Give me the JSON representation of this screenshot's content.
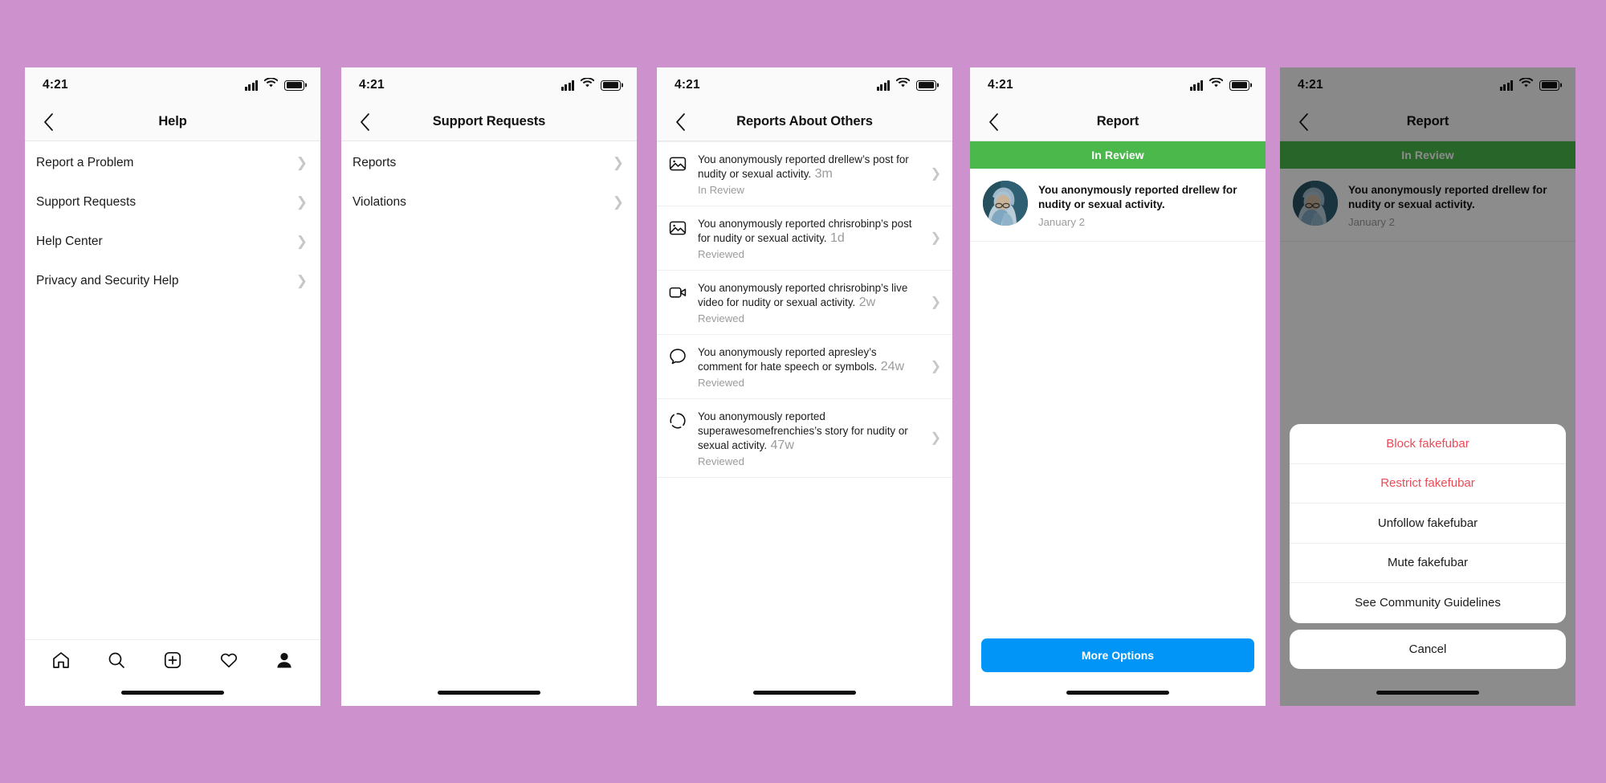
{
  "background_color": "#cd92ce",
  "accent_colors": {
    "primary_button": "#0095f6",
    "banner_green": "#4ab84a",
    "destructive_red": "#ed4956",
    "muted_text": "#9b9b9b"
  },
  "status_bar": {
    "time": "4:21",
    "signal_icon": "cellular-signal-icon",
    "wifi_icon": "wifi-icon",
    "battery_icon": "battery-full-icon"
  },
  "tab_bar": {
    "items": [
      {
        "name": "home",
        "icon": "home-icon"
      },
      {
        "name": "search",
        "icon": "search-icon"
      },
      {
        "name": "create",
        "icon": "plus-square-icon"
      },
      {
        "name": "activity",
        "icon": "heart-icon"
      },
      {
        "name": "profile",
        "icon": "profile-person-icon"
      }
    ]
  },
  "screens": [
    {
      "id": "help",
      "title": "Help",
      "back_icon": "chevron-left-icon",
      "items": [
        {
          "label": "Report a Problem"
        },
        {
          "label": "Support Requests"
        },
        {
          "label": "Help Center"
        },
        {
          "label": "Privacy and Security Help"
        }
      ]
    },
    {
      "id": "support-requests",
      "title": "Support Requests",
      "back_icon": "chevron-left-icon",
      "items": [
        {
          "label": "Reports"
        },
        {
          "label": "Violations"
        }
      ]
    },
    {
      "id": "reports-about-others",
      "title": "Reports About Others",
      "back_icon": "chevron-left-icon",
      "reports": [
        {
          "icon": "photo-icon",
          "text": "You anonymously reported drellew’s post for nudity or sexual activity.",
          "time": "3m",
          "status": "In Review"
        },
        {
          "icon": "photo-icon",
          "text": "You anonymously reported chrisrobinp’s post for nudity or sexual activity.",
          "time": "1d",
          "status": "Reviewed"
        },
        {
          "icon": "video-camera-icon",
          "text": "You anonymously reported chrisrobinp’s live video for nudity or sexual activity.",
          "time": "2w",
          "status": "Reviewed"
        },
        {
          "icon": "comment-bubble-icon",
          "text": "You anonymously reported apresley’s comment for hate speech or symbols.",
          "time": "24w",
          "status": "Reviewed"
        },
        {
          "icon": "story-ring-icon",
          "text": "You anonymously reported superawesomefrenchies’s story for nudity or sexual activity.",
          "time": "47w",
          "status": "Reviewed"
        }
      ]
    },
    {
      "id": "report-detail",
      "title": "Report",
      "back_icon": "chevron-left-icon",
      "banner": "In Review",
      "detail": {
        "avatar_icon": "user-avatar-photo",
        "text": "You anonymously reported drellew for nudity or sexual activity.",
        "date": "January 2"
      },
      "primary_button": "More Options"
    },
    {
      "id": "report-detail-action-sheet",
      "title": "Report",
      "back_icon": "chevron-left-icon",
      "banner": "In Review",
      "detail": {
        "avatar_icon": "user-avatar-photo",
        "text": "You anonymously reported drellew for nudity or sexual activity.",
        "date": "January 2"
      },
      "action_sheet": {
        "options": [
          {
            "label": "Block fakefubar",
            "style": "destructive"
          },
          {
            "label": "Restrict fakefubar",
            "style": "destructive"
          },
          {
            "label": "Unfollow fakefubar",
            "style": "default"
          },
          {
            "label": "Mute fakefubar",
            "style": "default"
          },
          {
            "label": "See Community Guidelines",
            "style": "default"
          }
        ],
        "cancel": "Cancel"
      }
    }
  ]
}
